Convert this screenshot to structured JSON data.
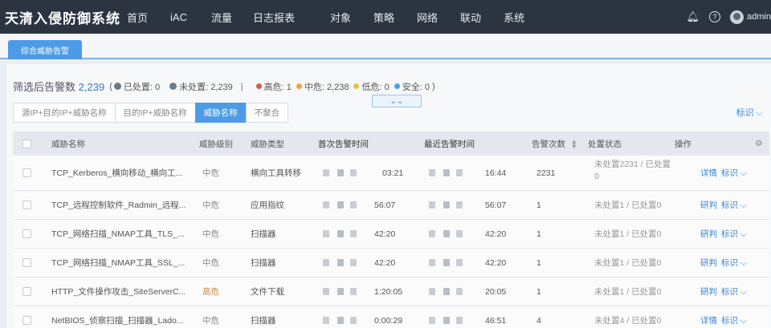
{
  "app": {
    "title": "天清入侵防御系统"
  },
  "nav": [
    "首页",
    "iAC",
    "流量",
    "日志报表",
    "对象",
    "策略",
    "网络",
    "联动",
    "系统"
  ],
  "header_right": {
    "help_label": "?",
    "user": "admin"
  },
  "tabs": [
    {
      "label": "综合威胁告警"
    }
  ],
  "summary": {
    "label": "筛选后告警数",
    "total": "2,239",
    "handled": "已处置: 0",
    "unhandled": "未处置: 2,239",
    "divider": "|",
    "high": "高危: 1",
    "mid": "中危: 2,238",
    "low": "低危: 0",
    "safe": "安全: 0",
    "colors": {
      "high": "#e0564f",
      "mid": "#f0a338",
      "low": "#e6c23c",
      "safe": "#4aa0e6"
    }
  },
  "collapse_icon": "chevron-double-down",
  "group_options": [
    {
      "label": "源IP+目的IP+威胁名称",
      "active": false
    },
    {
      "label": "目的IP+威胁名称",
      "active": false
    },
    {
      "label": "威胁名称",
      "active": true
    },
    {
      "label": "不聚合",
      "active": false
    }
  ],
  "tag_menu": "标识",
  "table": {
    "headers": {
      "name": "威胁名称",
      "level": "威胁级别",
      "type": "威胁类型",
      "first_time": "首次告警时间",
      "last_time": "最近告警时间",
      "count": "告警次数",
      "status": "处置状态",
      "ops": "操作"
    },
    "rows": [
      {
        "name": "TCP_Kerberos_横向移动_横向工...",
        "level": "中危",
        "type": "横向工具转移",
        "first_time": "03:21",
        "last_time": "16:44",
        "count": "2231",
        "status": "未处置2231 / 已处置0",
        "op1": "详情",
        "op2": "标识"
      },
      {
        "name": "TCP_远程控制软件_Radmin_远程...",
        "level": "中危",
        "type": "应用指纹",
        "first_time": "56:07",
        "last_time": "56:07",
        "count": "1",
        "status": "未处置1 / 已处置0",
        "op1": "研判",
        "op2": "标识"
      },
      {
        "name": "TCP_网络扫描_NMAP工具_TLS_...",
        "level": "中危",
        "type": "扫描器",
        "first_time": "42:20",
        "last_time": "42:20",
        "count": "1",
        "status": "未处置1 / 已处置0",
        "op1": "研判",
        "op2": "标识"
      },
      {
        "name": "TCP_网络扫描_NMAP工具_SSL_...",
        "level": "中危",
        "type": "扫描器",
        "first_time": "42:20",
        "last_time": "42:20",
        "count": "1",
        "status": "未处置1 / 已处置0",
        "op1": "研判",
        "op2": "标识"
      },
      {
        "name": "HTTP_文件操作攻击_SiteServerC...",
        "level": "高危",
        "type": "文件下载",
        "first_time": "1:20:05",
        "last_time": "20:05",
        "count": "1",
        "status": "未处置1 / 已处置0",
        "op1": "研判",
        "op2": "标识"
      },
      {
        "name": "NetBIOS_侦察扫描_扫描器_Lado...",
        "level": "中危",
        "type": "扫描器",
        "first_time": "0:00:29",
        "last_time": "46:51",
        "count": "4",
        "status": "未处置4 / 已处置0",
        "op1": "详情",
        "op2": "标识"
      }
    ]
  }
}
